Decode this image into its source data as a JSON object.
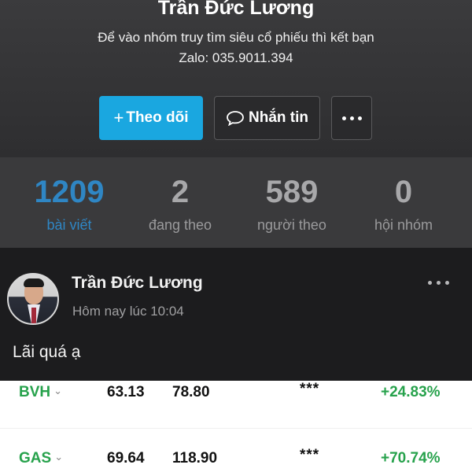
{
  "profile": {
    "name": "Trần Đức Lương",
    "bio_line1": "Để vào nhóm truy tìm siêu cổ phiếu thì kết bạn",
    "bio_line2": "Zalo: 035.9011.394"
  },
  "actions": {
    "follow_label": "Theo dõi",
    "follow_icon": "plus-icon",
    "message_label": "Nhắn tin",
    "message_icon": "chat-bubble-icon",
    "more_icon": "more-dots-icon"
  },
  "stats": [
    {
      "value": "1209",
      "label": "bài viết",
      "active": true
    },
    {
      "value": "2",
      "label": "đang theo",
      "active": false
    },
    {
      "value": "589",
      "label": "người theo",
      "active": false
    },
    {
      "value": "0",
      "label": "hội nhóm",
      "active": false
    }
  ],
  "post": {
    "author": "Trần Đức Lương",
    "time": "Hôm nay lúc 10:04",
    "text": "Lãi quá ạ"
  },
  "stock_rows": [
    {
      "ticker": "BVH",
      "buy_price": "63.13",
      "current_price": "78.80",
      "volume": "***",
      "change": "+24.83%"
    },
    {
      "ticker": "GAS",
      "buy_price": "69.64",
      "current_price": "118.90",
      "volume": "***",
      "change": "+70.74%"
    }
  ],
  "colors": {
    "accent_blue": "#1aa7e0",
    "active_stat": "#2f86c4",
    "gain_green": "#27a24c"
  }
}
